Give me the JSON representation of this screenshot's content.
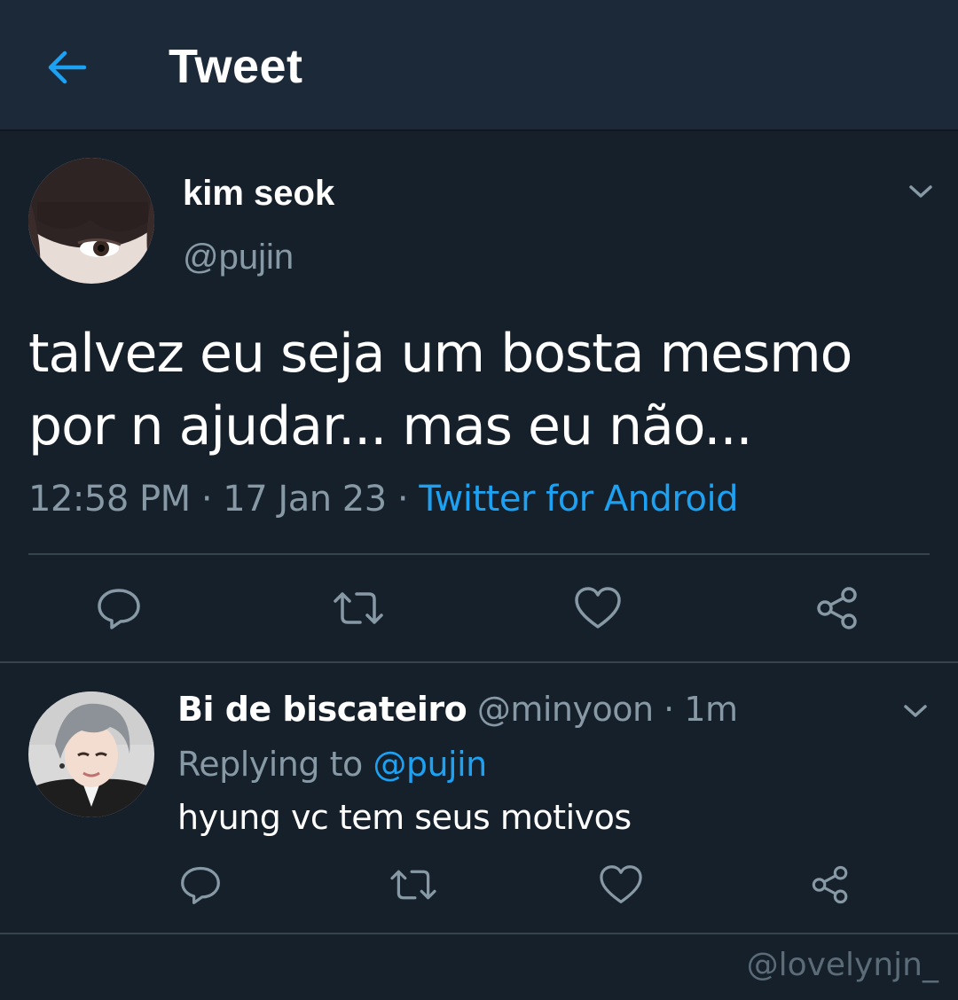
{
  "header": {
    "title": "Tweet",
    "back_icon": "arrow-left-icon",
    "accent_color": "#1da1f2"
  },
  "tweet": {
    "name": "kim seok",
    "handle": "@pujin",
    "text": "talvez eu seja um bosta mesmo por n ajudar... mas eu não...",
    "time": "12:58 PM",
    "sep1": "·",
    "date": "17 Jan 23",
    "sep2": "·",
    "source": "Twitter for Android",
    "actions": [
      "reply-icon",
      "retweet-icon",
      "like-icon",
      "share-icon"
    ]
  },
  "reply": {
    "name": "Bi de biscateiro",
    "handle": "@minyoon",
    "sep": "·",
    "time": "1m",
    "replying_prefix": "Replying to",
    "replying_to": "@pujin",
    "text": "hyung vc tem seus motivos",
    "actions": [
      "reply-icon",
      "retweet-icon",
      "like-icon",
      "share-icon"
    ]
  },
  "watermark": "@lovelynjn_",
  "colors": {
    "background": "#15202b",
    "header_bg": "#1c2938",
    "secondary_text": "#8899a6",
    "divider": "#38444d",
    "link": "#1da1f2"
  }
}
